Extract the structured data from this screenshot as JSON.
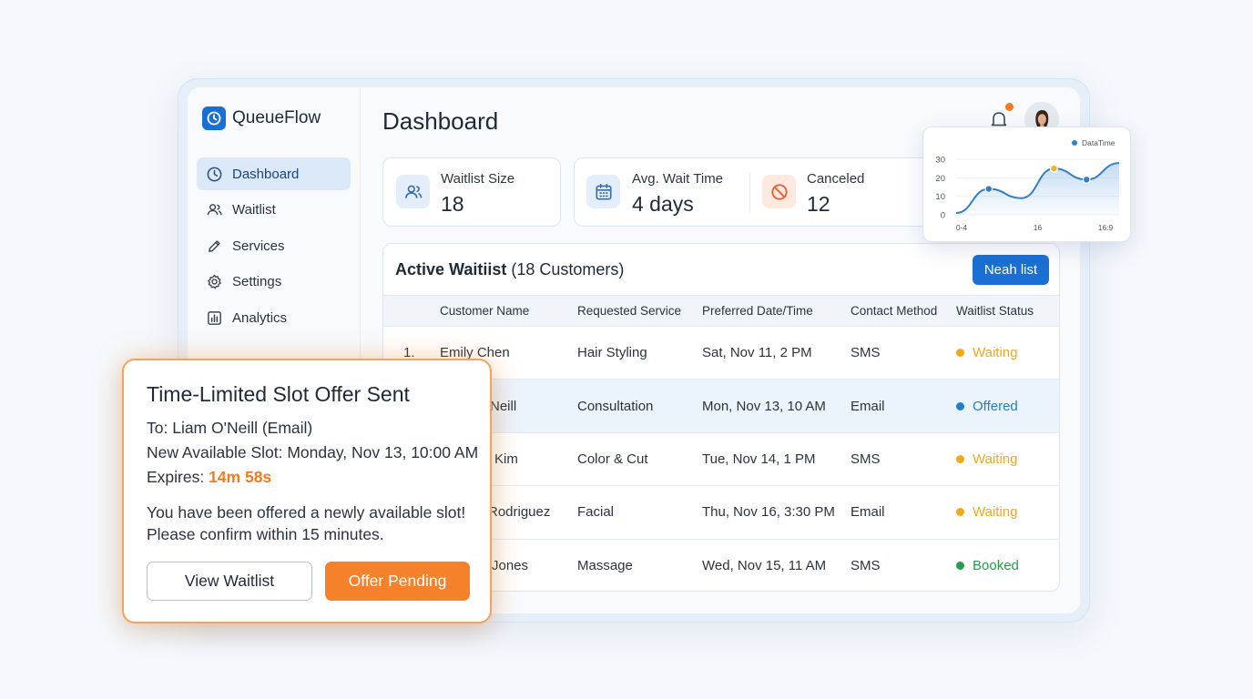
{
  "app": {
    "name": "QueueFlow",
    "brand_color": "#1a6fd4",
    "accent_color": "#f47a1f"
  },
  "sidebar": {
    "items": [
      {
        "label": "Dashboard",
        "icon": "clock-icon",
        "active": true
      },
      {
        "label": "Waitlist",
        "icon": "users-icon"
      },
      {
        "label": "Services",
        "icon": "pencil-icon"
      },
      {
        "label": "Settings",
        "icon": "gear-icon"
      },
      {
        "label": "Analytics",
        "icon": "bar-chart-icon"
      }
    ]
  },
  "header": {
    "title": "Dashboard",
    "has_notification": true
  },
  "stats": {
    "waitlist_size": {
      "label": "Waitlist Size",
      "value": "18",
      "icon": "users-icon"
    },
    "avg_wait": {
      "label": "Avg. Wait Time",
      "value": "4 days",
      "icon": "calendar-icon"
    },
    "canceled": {
      "label": "Canceled",
      "value": "12",
      "icon": "ban-icon"
    }
  },
  "table": {
    "title_bold": "Active Waitiist",
    "title_rest": " (18 Customers)",
    "action_label": "Neah list",
    "columns": [
      "",
      "Customer Name",
      "Requested Service",
      "Preferred Date/Time",
      "Contact Method",
      "Waitlist Status"
    ],
    "rows": [
      {
        "num": "1.",
        "name": "Emily Chen",
        "service": "Hair Styling",
        "datetime": "Sat, Nov 11, 2 PM",
        "contact": "SMS",
        "status": "Waiting",
        "status_color": "#f0a818",
        "highlight": false
      },
      {
        "num": "",
        "name": "Neill",
        "service": "Consultation",
        "datetime": "Mon, Nov 13, 10 AM",
        "contact": "Email",
        "status": "Offered",
        "status_color": "#1f7fd0",
        "highlight": true
      },
      {
        "num": "",
        "name": "Kim",
        "service": "Color & Cut",
        "datetime": "Tue, Nov 14, 1 PM",
        "contact": "SMS",
        "status": "Waiting",
        "status_color": "#f0a818",
        "highlight": false
      },
      {
        "num": "",
        "name": "Rodriguez",
        "service": "Facial",
        "datetime": "Thu, Nov 16, 3:30 PM",
        "contact": "Email",
        "status": "Waiting",
        "status_color": "#f0a818",
        "highlight": false
      },
      {
        "num": "",
        "name": "Jones",
        "service": "Massage",
        "datetime": "Wed, Nov 15, 11 AM",
        "contact": "SMS",
        "status": "Booked",
        "status_color": "#21a04a",
        "highlight": false
      }
    ]
  },
  "chart_data": {
    "type": "line",
    "legend": "DataTime",
    "legend_position": "top-right",
    "x_tick_labels": [
      "0-4",
      "16",
      "16:9"
    ],
    "y_ticks": [
      0,
      10,
      20,
      30
    ],
    "ylim": [
      0,
      30
    ],
    "series": [
      {
        "name": "DataTime",
        "color": "#2f7fc9",
        "points": [
          [
            0,
            1
          ],
          [
            1,
            14
          ],
          [
            2,
            9
          ],
          [
            3,
            25
          ],
          [
            4,
            19
          ],
          [
            5,
            28
          ]
        ]
      }
    ],
    "highlighted_points": [
      [
        1,
        14
      ],
      [
        3,
        25
      ],
      [
        4,
        19
      ]
    ],
    "highlight_colors": [
      "#2f7fc9",
      "#f0b429",
      "#2f7fc9"
    ],
    "grid": true
  },
  "toast": {
    "title": "Time-Limited Slot Offer Sent",
    "to": "To: Liam O'Neill (Email)",
    "slot": "New Available Slot: Monday, Nov 13, 10:00 AM",
    "expires_label": "Expires: ",
    "expires_value": "14m 58s",
    "message_1": "You have been offered a newly available slot!",
    "message_2": "Please confirm within 15 minutes.",
    "secondary_button": "View Waitlist",
    "primary_button": "Offer Pending"
  }
}
